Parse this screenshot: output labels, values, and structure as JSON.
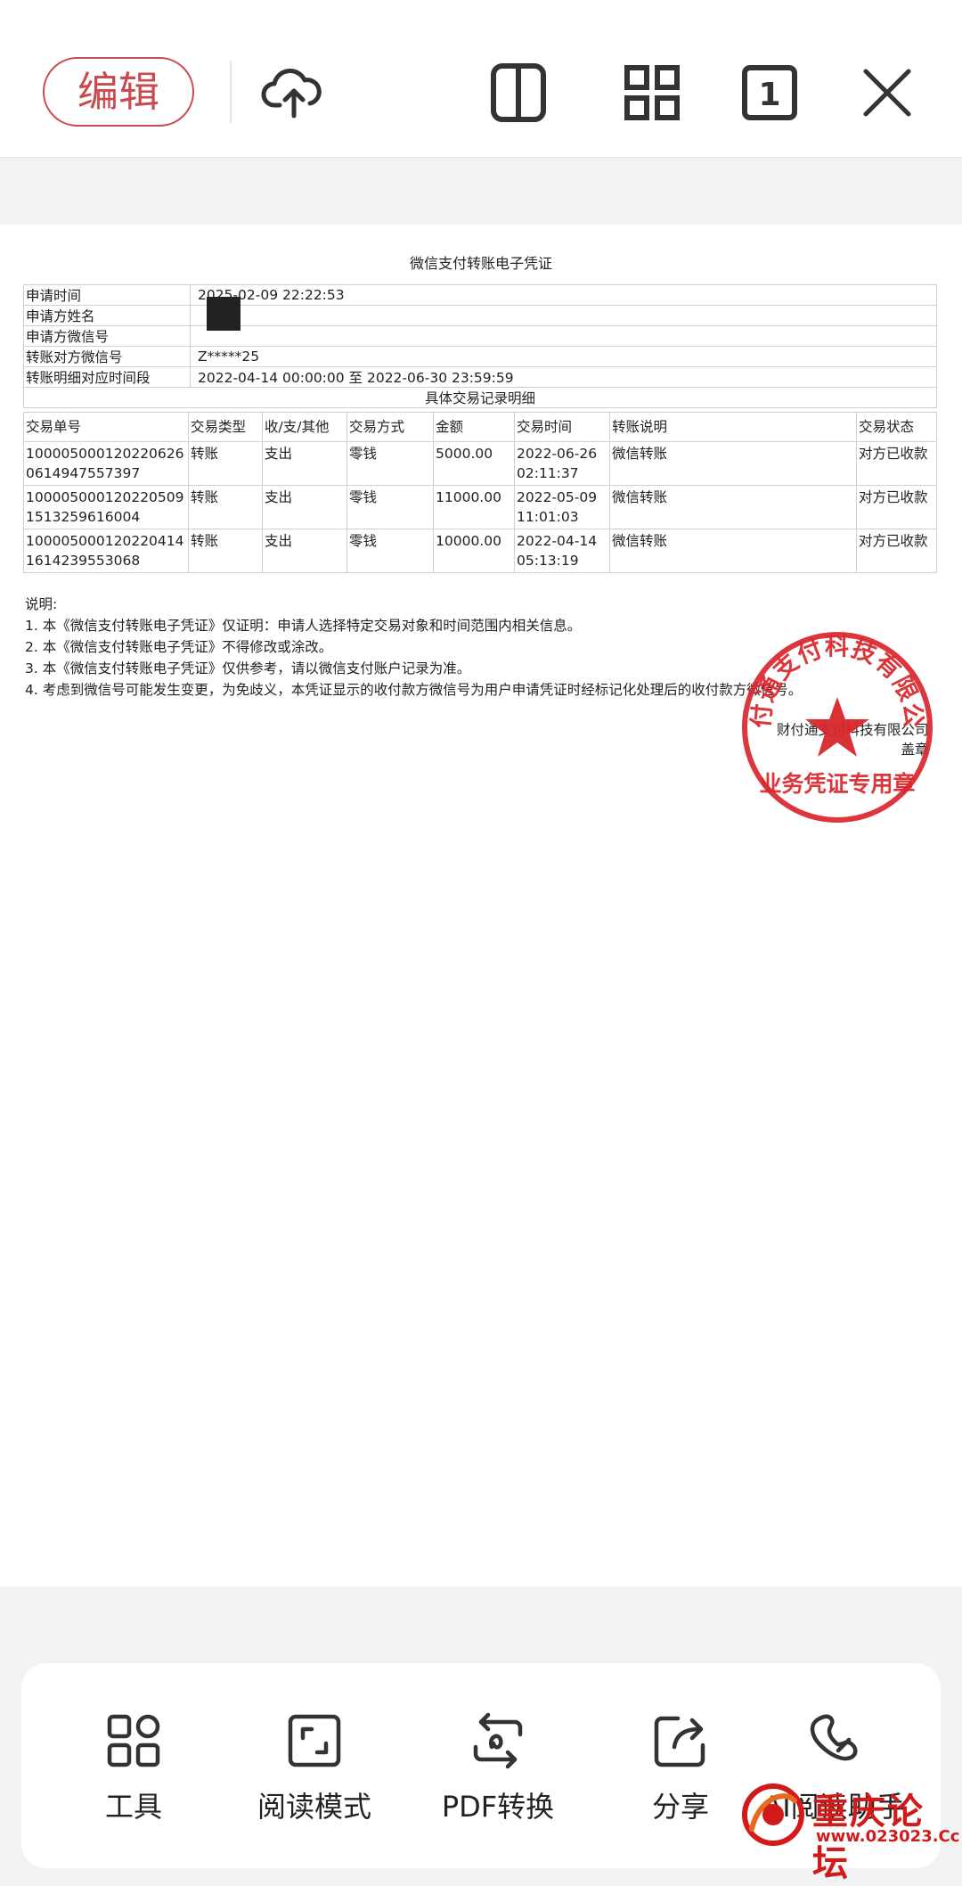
{
  "toolbar": {
    "edit_label": "编辑",
    "icons": [
      "cloud-upload-icon",
      "split-view-icon",
      "grid-view-icon",
      "page-one-icon",
      "close-icon"
    ],
    "page_badge": "1",
    "accent_color": "#c94a4f"
  },
  "document": {
    "title": "微信支付转账电子凭证",
    "info": [
      {
        "label": "申请时间",
        "value": "2025-02-09 22:22:53"
      },
      {
        "label": "申请方姓名",
        "value": ""
      },
      {
        "label": "申请方微信号",
        "value": ""
      },
      {
        "label": "转账对方微信号",
        "value": "Z*****25"
      },
      {
        "label": "转账明细对应时间段",
        "value": "2022-04-14 00:00:00 至 2022-06-30 23:59:59"
      }
    ],
    "section_title": "具体交易记录明细",
    "columns": [
      "交易单号",
      "交易类型",
      "收/支/其他",
      "交易方式",
      "金额",
      "交易时间",
      "转账说明",
      "交易状态"
    ],
    "rows": [
      {
        "id_line1": "100005000120220626",
        "id_line2": "0614947557397",
        "type": "转账",
        "direction": "支出",
        "method": "零钱",
        "amount": "5000.00",
        "date": "2022-06-26",
        "time": "02:11:37",
        "memo": "微信转账",
        "status": "对方已收款"
      },
      {
        "id_line1": "100005000120220509",
        "id_line2": "1513259616004",
        "type": "转账",
        "direction": "支出",
        "method": "零钱",
        "amount": "11000.00",
        "date": "2022-05-09",
        "time": "11:01:03",
        "memo": "微信转账",
        "status": "对方已收款"
      },
      {
        "id_line1": "100005000120220414",
        "id_line2": "1614239553068",
        "type": "转账",
        "direction": "支出",
        "method": "零钱",
        "amount": "10000.00",
        "date": "2022-04-14",
        "time": "05:13:19",
        "memo": "微信转账",
        "status": "对方已收款"
      }
    ],
    "notes_title": "说明:",
    "notes": [
      "1. 本《微信支付转账电子凭证》仅证明：申请人选择特定交易对象和时间范围内相关信息。",
      "2. 本《微信支付转账电子凭证》不得修改或涂改。",
      "3. 本《微信支付转账电子凭证》仅供参考，请以微信支付账户记录为准。",
      "4. 考虑到微信号可能发生变更，为免歧义，本凭证显示的收付款方微信号为用户申请凭证时经标记化处理后的收付款方微信号。"
    ],
    "company_line": "财付通支付科技有限公司",
    "company_sub": "盖章",
    "seal": {
      "arc_text": "财付通支付科技有限公司",
      "bottom_text": "业务凭证专用章",
      "color": "#d8262c"
    }
  },
  "bottom_bar": {
    "items": [
      {
        "label": "工具",
        "icon": "tools-icon"
      },
      {
        "label": "阅读模式",
        "icon": "fullscreen-icon"
      },
      {
        "label": "PDF转换",
        "icon": "pdf-convert-icon"
      },
      {
        "label": "分享",
        "icon": "share-icon"
      },
      {
        "label": "AI阅读助手",
        "icon": "ai-assistant-icon"
      }
    ]
  },
  "watermark": {
    "text": "重庆论坛",
    "url": "www.023023.Cc"
  }
}
